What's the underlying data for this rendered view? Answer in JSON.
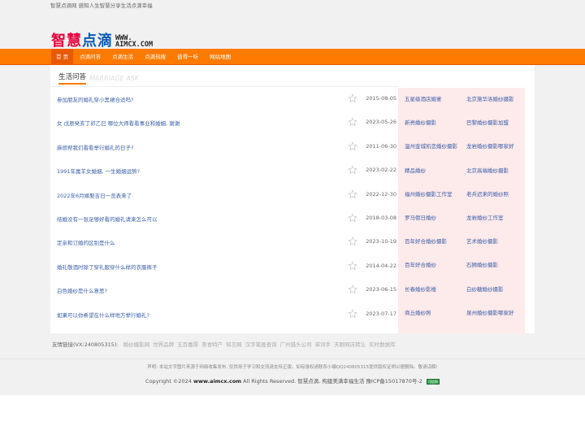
{
  "topbar": {
    "text": "智慧点滴网 感知人生智慧分享生活点滴幸福"
  },
  "logo": {
    "cn_a": "智慧",
    "cn_b": "点滴",
    "en_line1": "WWW.",
    "en_line2": "AIMCX.COM"
  },
  "nav": [
    {
      "label": "首 页"
    },
    {
      "label": "点滴问答"
    },
    {
      "label": "点滴生活"
    },
    {
      "label": "点滴热搜"
    },
    {
      "label": "值得一听"
    },
    {
      "label": "网站地图"
    }
  ],
  "section": {
    "title": "生活问答",
    "title_en": "MARRIAGE ASK"
  },
  "questions": [
    {
      "title": "参加朋友的婚礼穿小黑裙合适吗?",
      "date": "2015-08-05"
    },
    {
      "title": "女 戊辰癸亥丁卯乙巳 哪位大师看看事业和婚姻, 谢谢",
      "date": "2023-05-26"
    },
    {
      "title": "麻烦帮我们看看举行婚礼的日子?",
      "date": "2011-06-30"
    },
    {
      "title": "1991年属羊女婚姻, 一生婚姻运势?",
      "date": "2023-02-22"
    },
    {
      "title": "2022年6月嫁娶吉日一览表来了",
      "date": "2022-12-30"
    },
    {
      "title": "结婚没有一张足够好看的婚礼请柬怎么可以",
      "date": "2018-03-08"
    },
    {
      "title": "定亲和订婚的区别是什么",
      "date": "2023-10-19"
    },
    {
      "title": "婚礼敬酒时除了穿礼服穿什么样的衣服裤子",
      "date": "2014-04-22"
    },
    {
      "title": "白色婚纱是什么意思?",
      "date": "2023-06-15"
    },
    {
      "title": "如果可以你希望在什么样地方举行婚礼?",
      "date": "2023-07-17"
    }
  ],
  "sidebar": [
    {
      "label": "五星级酒店婚宴"
    },
    {
      "label": "北京施华洛婚纱摄影"
    },
    {
      "label": "新亮婚纱摄影"
    },
    {
      "label": "巴黎婚纱摄影加盟"
    },
    {
      "label": "温州金城凯恋婚纱摄影"
    },
    {
      "label": "龙岩婚纱摄影哪家好"
    },
    {
      "label": "精品婚纱"
    },
    {
      "label": "北京高端婚纱摄影"
    },
    {
      "label": "福州婚纱摄影工作室"
    },
    {
      "label": "老兵迟来的婚纱照"
    },
    {
      "label": "罗马假日婚纱"
    },
    {
      "label": "龙岩婚纱工作室"
    },
    {
      "label": "百年好合婚纱摄影"
    },
    {
      "label": "艺术婚纱摄影"
    },
    {
      "label": "百年好合婚纱"
    },
    {
      "label": "石狮婚纱摄影"
    },
    {
      "label": "长春婚纱影楼"
    },
    {
      "label": "白纱糖婚纱摄影"
    },
    {
      "label": "商丘婚纱照"
    },
    {
      "label": "泉州婚纱摄影哪家好"
    }
  ],
  "friend": {
    "label": "友情链接(VX:240805315):",
    "links": [
      {
        "label": "婚纱摄影网"
      },
      {
        "label": "世界品牌"
      },
      {
        "label": "五百嘉厚"
      },
      {
        "label": "美食特产"
      },
      {
        "label": "知言网"
      },
      {
        "label": "汉字笔画查询"
      },
      {
        "label": "广州猎头公司"
      },
      {
        "label": "单词手"
      },
      {
        "label": "天眼网店转让"
      },
      {
        "label": "实时数据库"
      }
    ]
  },
  "footer": {
    "disclaimer": "声明: 本站文字图片来源于网络收集发布, 仅供用于学习和交流请支持正版。如有侵权请联系小编QQ240805315提供版权证明以便删除。敬请谅解!",
    "copyright_pre": "Copyright ©2024",
    "site": "www.aimcx.com",
    "copyright_post": "All Rights Reserved. 智慧点滴, 构建美满幸福生活 豫ICP备15017870号-2",
    "badge": "可信网站"
  },
  "colors": {
    "accent": "#ff7a00",
    "logo_red": "#e6003a",
    "logo_blue": "#0a59b6",
    "link": "#3a5ea8",
    "sidebar_bg": "#fdeaea"
  }
}
